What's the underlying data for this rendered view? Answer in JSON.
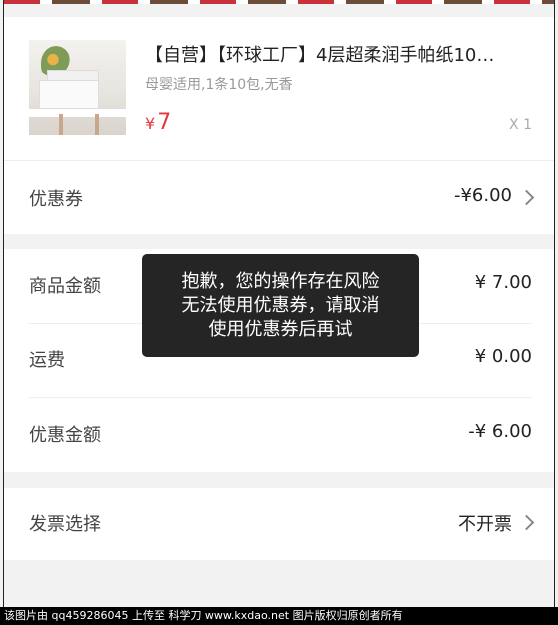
{
  "product": {
    "title": "【自营】【环球工厂】4层超柔润手帕纸10…",
    "spec": "母婴适用,1条10包,无香",
    "price_currency": "¥",
    "price_value": "7",
    "quantity": "X 1"
  },
  "coupon": {
    "label": "优惠券",
    "value": "-¥6.00"
  },
  "summary": {
    "goods_label": "商品金额",
    "goods_value": "¥ 7.00",
    "shipping_label": "运费",
    "shipping_value": "¥ 0.00",
    "discount_label": "优惠金额",
    "discount_value": "-¥ 6.00"
  },
  "invoice": {
    "label": "发票选择",
    "value": "不开票"
  },
  "toast": {
    "line1": "抱歉，您的操作存在风险",
    "line2": "无法使用优惠券，请取消",
    "line3": "使用优惠券后再试"
  },
  "watermark": {
    "text": "该图片由 qq459286045 上传至 科学刀 www.kxdao.net 图片版权归原创者所有"
  },
  "colors": {
    "price_red": "#e4393c",
    "toast_bg": "#141414"
  }
}
